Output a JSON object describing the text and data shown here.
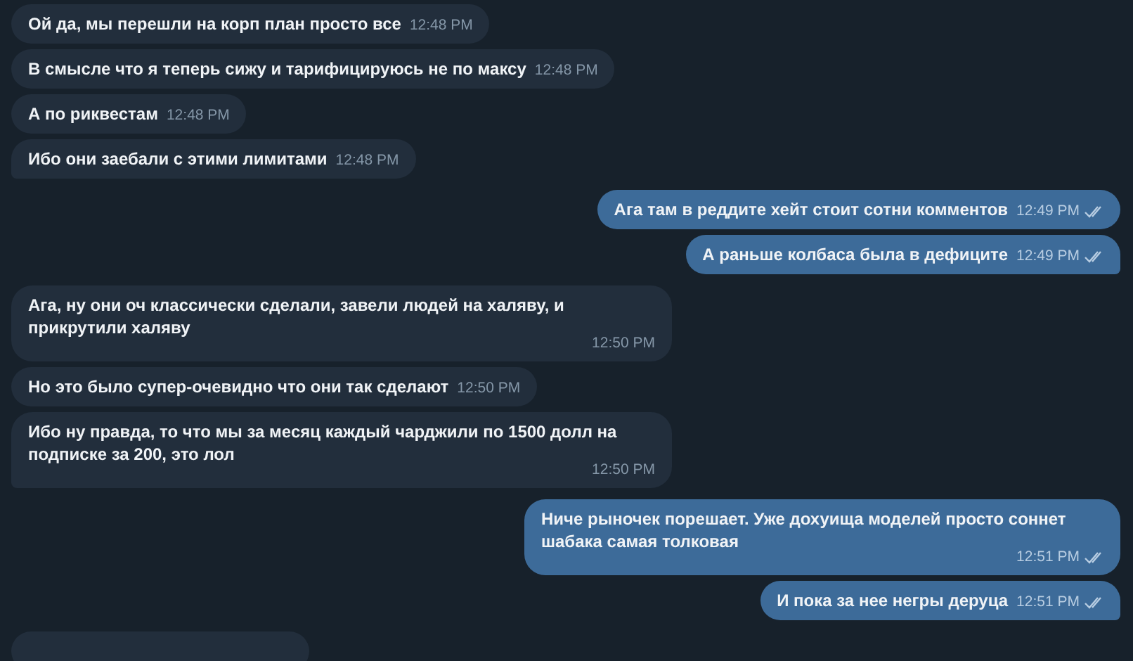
{
  "messages": [
    {
      "kind": "text",
      "outgoing": false,
      "tail": false,
      "text": "Ой да, мы перешли на корп план просто все",
      "time": "12:48 PM"
    },
    {
      "kind": "text",
      "outgoing": false,
      "tail": false,
      "text": "В смысле что я теперь сижу и тарифицируюсь не по максу",
      "time": "12:48 PM"
    },
    {
      "kind": "text",
      "outgoing": false,
      "tail": false,
      "text": "А по риквестам",
      "time": "12:48 PM"
    },
    {
      "kind": "text",
      "outgoing": false,
      "tail": true,
      "text": "Ибо они заебали с этими лимитами",
      "time": "12:48 PM"
    },
    {
      "kind": "text",
      "outgoing": true,
      "tail": false,
      "read": true,
      "text": "Ага там в реддите хейт стоит сотни комментов",
      "time": "12:49 PM"
    },
    {
      "kind": "text",
      "outgoing": true,
      "tail": true,
      "read": true,
      "text": "А раньше колбаса была в дефиците",
      "time": "12:49 PM"
    },
    {
      "kind": "text",
      "outgoing": false,
      "tail": false,
      "text": "Ага, ну они оч классически сделали, завели людей на халяву, и прикрутили халяву",
      "time": "12:50 PM"
    },
    {
      "kind": "text",
      "outgoing": false,
      "tail": false,
      "text": "Но это было супер-очевидно что они так сделают",
      "time": "12:50 PM"
    },
    {
      "kind": "text",
      "outgoing": false,
      "tail": true,
      "text": "Ибо ну правда, то что мы за месяц каждый чарджили по 1500 долл на подписке за 200, это лол",
      "time": "12:50 PM"
    },
    {
      "kind": "text",
      "outgoing": true,
      "tail": false,
      "read": true,
      "text": "Ниче рыночек порешает. Уже дохуища моделей просто соннет шабака самая толковая",
      "time": "12:51 PM"
    },
    {
      "kind": "text",
      "outgoing": true,
      "tail": true,
      "read": true,
      "text": "И пока за нее негры деруца",
      "time": "12:51 PM"
    },
    {
      "kind": "cut",
      "outgoing": false
    }
  ]
}
